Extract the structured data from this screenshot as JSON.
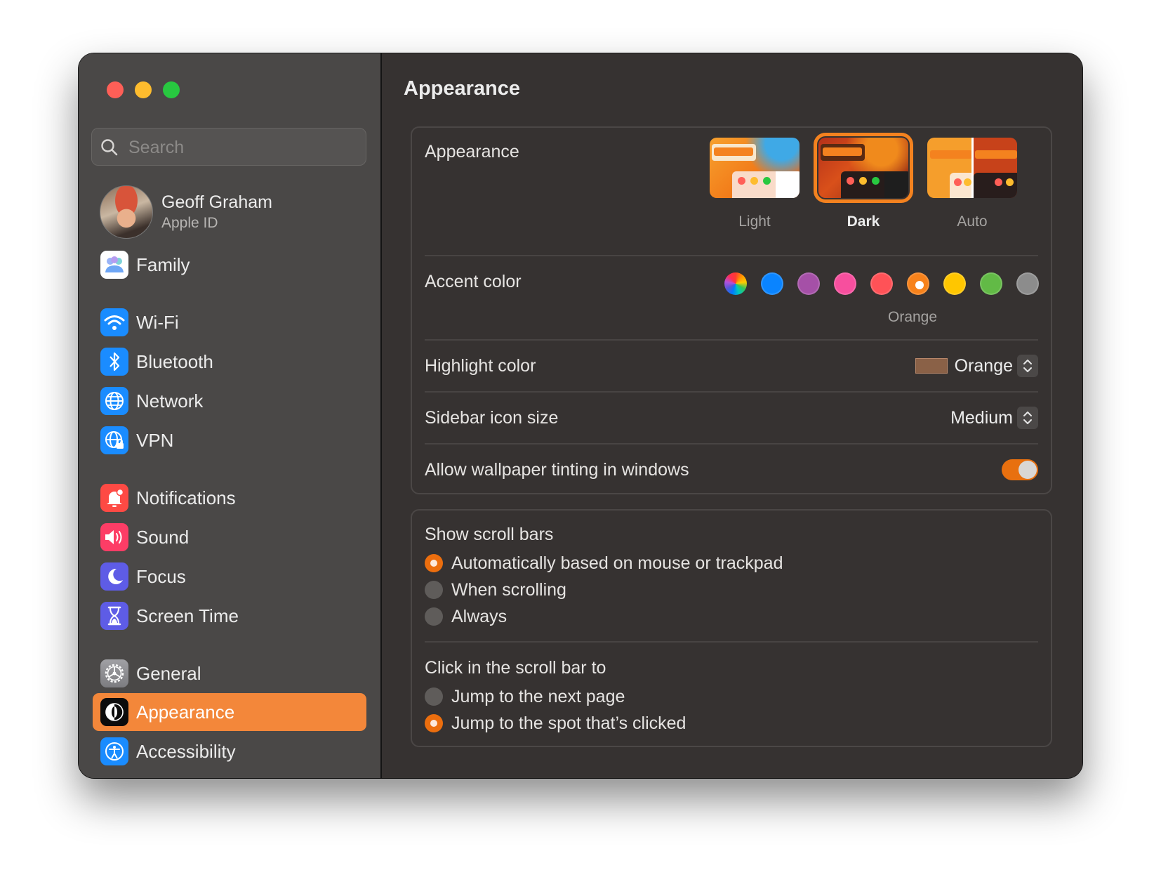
{
  "window": {
    "traffic_lights": [
      "close",
      "minimize",
      "zoom"
    ]
  },
  "sidebar": {
    "search_placeholder": "Search",
    "search_value": "",
    "profile": {
      "name": "Geoff Graham",
      "subtitle": "Apple ID"
    },
    "items": [
      {
        "label": "Family",
        "icon": "family-icon",
        "color": "#ffffff",
        "active": false
      },
      {
        "label": "Wi-Fi",
        "icon": "wifi-icon",
        "color": "#1a8cff",
        "active": false
      },
      {
        "label": "Bluetooth",
        "icon": "bluetooth-icon",
        "color": "#1a8cff",
        "active": false
      },
      {
        "label": "Network",
        "icon": "globe-icon",
        "color": "#1a8cff",
        "active": false
      },
      {
        "label": "VPN",
        "icon": "vpn-globe-icon",
        "color": "#1a8cff",
        "active": false
      },
      {
        "label": "Notifications",
        "icon": "bell-icon",
        "color": "#fe4a44",
        "active": false
      },
      {
        "label": "Sound",
        "icon": "speaker-icon",
        "color": "#fd3d66",
        "active": false
      },
      {
        "label": "Focus",
        "icon": "moon-icon",
        "color": "#5e5ce6",
        "active": false
      },
      {
        "label": "Screen Time",
        "icon": "hourglass-icon",
        "color": "#5e5ce6",
        "active": false
      },
      {
        "label": "General",
        "icon": "gear-icon",
        "color": "#8e8e93",
        "active": false
      },
      {
        "label": "Appearance",
        "icon": "appearance-icon",
        "color": "#000000",
        "active": true
      },
      {
        "label": "Accessibility",
        "icon": "accessibility-icon",
        "color": "#1a8cff",
        "active": false
      }
    ],
    "active_color": "#f3873a"
  },
  "main": {
    "title": "Appearance",
    "appearance": {
      "label": "Appearance",
      "options": [
        {
          "label": "Light",
          "selected": false
        },
        {
          "label": "Dark",
          "selected": true
        },
        {
          "label": "Auto",
          "selected": false
        }
      ]
    },
    "accent": {
      "label": "Accent color",
      "options": [
        {
          "name": "Multicolor",
          "color": "multicolor",
          "selected": false
        },
        {
          "name": "Blue",
          "color": "#0a84ff",
          "selected": false
        },
        {
          "name": "Purple",
          "color": "#a550a7",
          "selected": false
        },
        {
          "name": "Pink",
          "color": "#f74f9e",
          "selected": false
        },
        {
          "name": "Red",
          "color": "#ff5257",
          "selected": false
        },
        {
          "name": "Orange",
          "color": "#f7821b",
          "selected": true
        },
        {
          "name": "Yellow",
          "color": "#ffc600",
          "selected": false
        },
        {
          "name": "Green",
          "color": "#62ba46",
          "selected": false
        },
        {
          "name": "Graphite",
          "color": "#8c8c8c",
          "selected": false
        }
      ],
      "selected_caption": "Orange"
    },
    "highlight": {
      "label": "Highlight color",
      "value": "Orange",
      "swatch": "#8a6147"
    },
    "sidebar_icon_size": {
      "label": "Sidebar icon size",
      "value": "Medium"
    },
    "wallpaper_tinting": {
      "label": "Allow wallpaper tinting in windows",
      "enabled": true,
      "color": "#e8700f"
    },
    "scroll_bars": {
      "label": "Show scroll bars",
      "options": [
        {
          "label": "Automatically based on mouse or trackpad",
          "selected": true
        },
        {
          "label": "When scrolling",
          "selected": false
        },
        {
          "label": "Always",
          "selected": false
        }
      ]
    },
    "click_scroll_bar": {
      "label": "Click in the scroll bar to",
      "options": [
        {
          "label": "Jump to the next page",
          "selected": false
        },
        {
          "label": "Jump to the spot that’s clicked",
          "selected": true
        }
      ]
    }
  }
}
